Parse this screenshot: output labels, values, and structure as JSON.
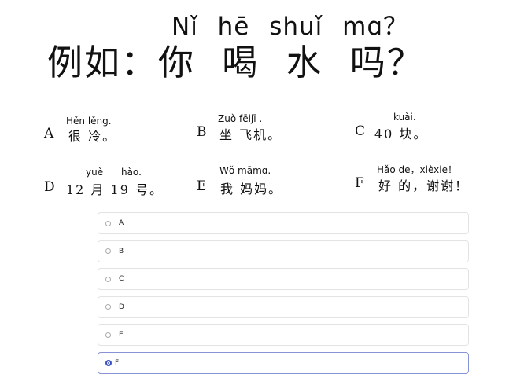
{
  "question": {
    "pinyin": "Nǐ  hē  shuǐ  mɑ？",
    "hanzi": "例如：你 喝 水 吗？"
  },
  "options": [
    {
      "letter": "A",
      "pinyin": "Hěn lěng.",
      "hanzi": "很 冷。"
    },
    {
      "letter": "B",
      "pinyin": "Zuò  fēijī .",
      "hanzi": "坐 飞机。"
    },
    {
      "letter": "C",
      "pinyin": "kuài.",
      "hanzi": "40 块。"
    },
    {
      "letter": "D",
      "pinyin": "yuè      hào.",
      "hanzi": "12 月 19 号。"
    },
    {
      "letter": "E",
      "pinyin": "Wǒ māmɑ.",
      "hanzi": "我 妈妈。"
    },
    {
      "letter": "F",
      "pinyin": "Hǎo de，xièxie！",
      "hanzi": "好 的，谢谢！"
    }
  ],
  "answers": [
    {
      "label": "A",
      "selected": false
    },
    {
      "label": "B",
      "selected": false
    },
    {
      "label": "C",
      "selected": false
    },
    {
      "label": "D",
      "selected": false
    },
    {
      "label": "E",
      "selected": false
    },
    {
      "label": "F",
      "selected": true
    }
  ],
  "colors": {
    "accent": "#3a4fc2",
    "selected_border": "#8892d6"
  }
}
